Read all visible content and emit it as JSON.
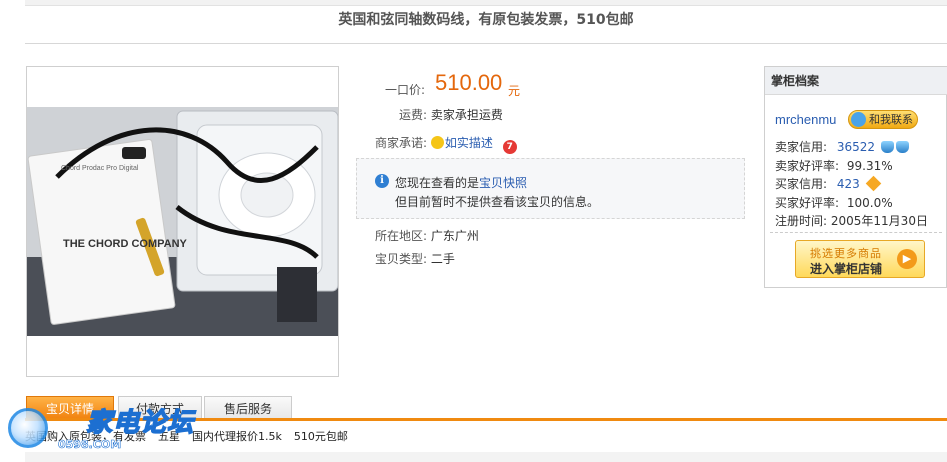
{
  "page_title": "英国和弦同轴数码线，有原包装发票，510包邮",
  "item": {
    "price_label": "一口价:",
    "price": "510.00",
    "price_unit": "元",
    "shipping_label": "运费:",
    "shipping_value": "卖家承担运费",
    "promise_label": "商家承诺:",
    "promise_value": "如实描述",
    "notice_prefix": "您现在查看的是",
    "notice_link": "宝贝快照",
    "notice_line2": "但目前暂时不提供查看该宝贝的信息。",
    "region_label": "所在地区:",
    "region_value": "广东广州",
    "type_label": "宝贝类型:",
    "type_value": "二手"
  },
  "seller": {
    "panel_title": "掌柜档案",
    "name": "mrchenmu",
    "contact_label": "和我联系",
    "seller_credit_label": "卖家信用:",
    "seller_credit_value": "36522",
    "seller_rate_label": "卖家好评率:",
    "seller_rate_value": "99.31%",
    "buyer_credit_label": "买家信用:",
    "buyer_credit_value": "423",
    "buyer_rate_label": "买家好评率:",
    "buyer_rate_value": "100.0%",
    "register_label": "注册时间:",
    "register_value": "2005年11月30日",
    "shop_btn_line1": "挑选更多商品",
    "shop_btn_line2": "进入掌柜店铺"
  },
  "tabs": [
    {
      "label": "宝贝详情"
    },
    {
      "label": "付款方式"
    },
    {
      "label": "售后服务"
    }
  ],
  "description_parts": [
    "英国购入原包装，有发票",
    "五星",
    "国内代理报价1.5k",
    "510元包邮"
  ],
  "watermark": {
    "text": "家电论坛",
    "sub": "0598.COM"
  },
  "photo_texts": {
    "brand": "THE CHORD COMPANY",
    "product": "Chord Prodac Pro Digital"
  },
  "colors": {
    "price": "#e4670c",
    "link": "#2a5db0",
    "tab_active": "#f07f0c"
  },
  "icons": [
    "info-icon",
    "guarantee-icon",
    "seven-day-icon",
    "crown-icon",
    "diamond-icon",
    "arrow-icon",
    "contact-face-icon"
  ]
}
